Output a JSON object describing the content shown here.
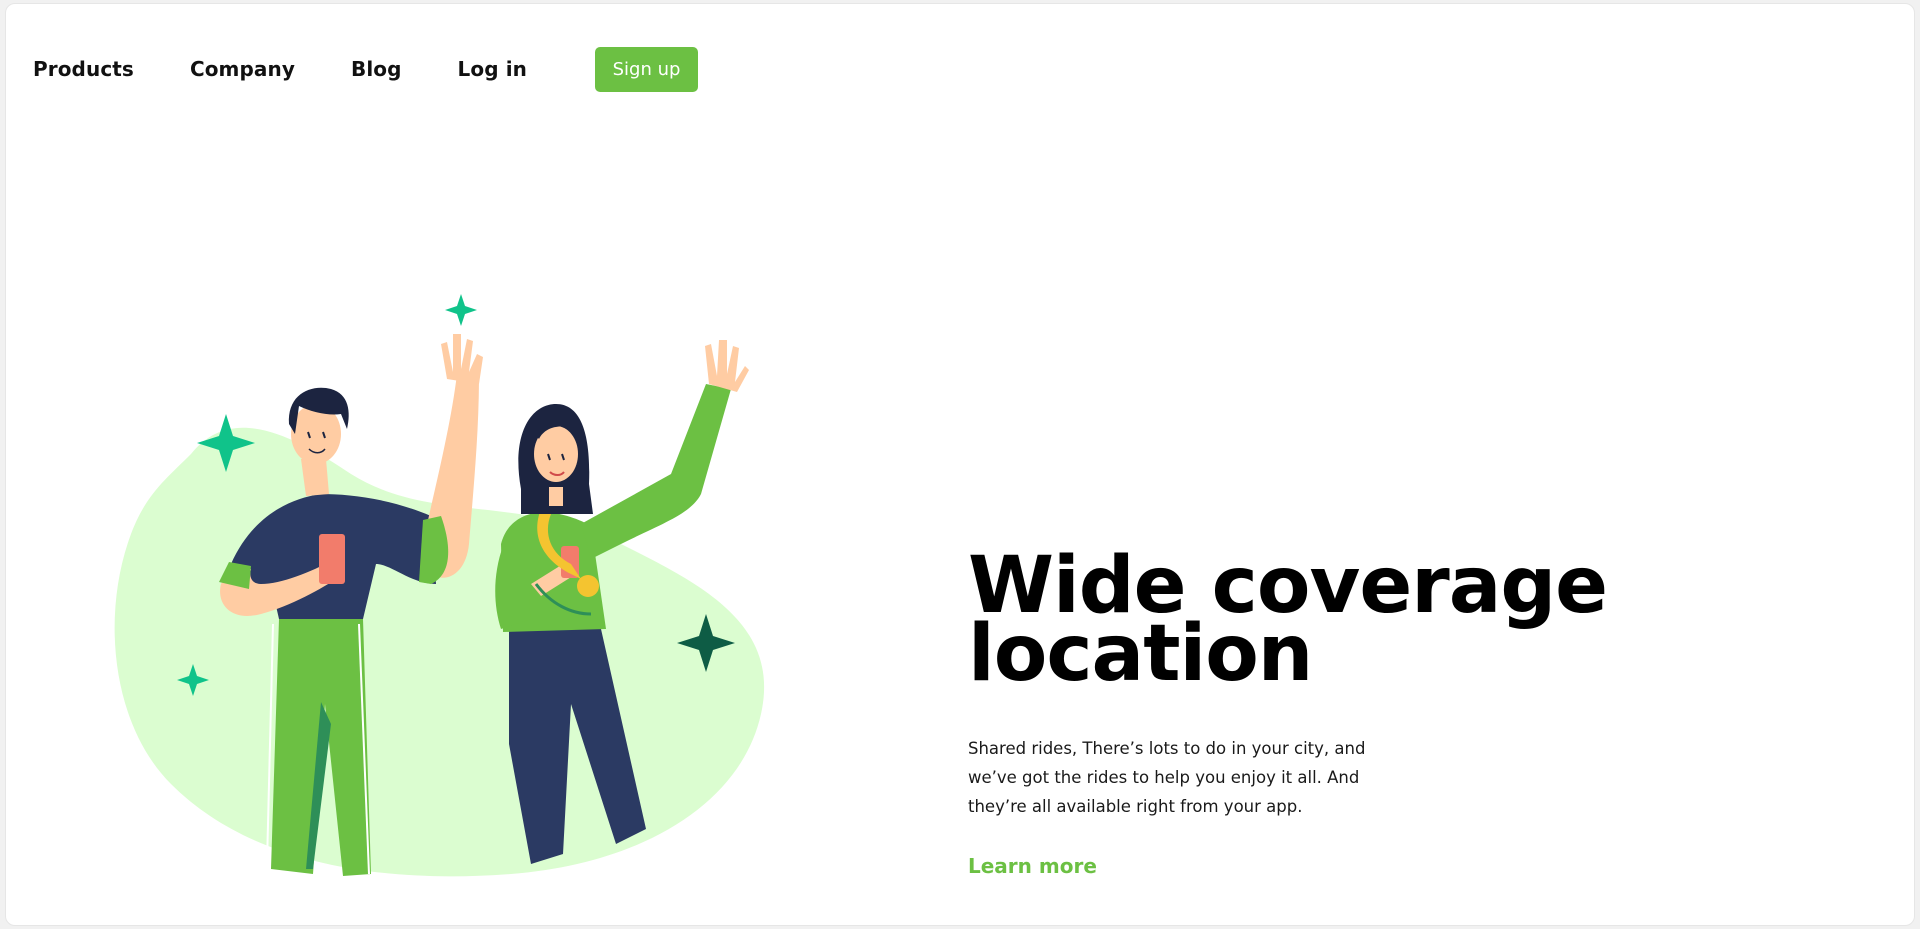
{
  "nav": {
    "items": [
      {
        "label": "Products"
      },
      {
        "label": "Company"
      },
      {
        "label": "Blog"
      },
      {
        "label": "Log in"
      }
    ],
    "signup_label": "Sign up"
  },
  "hero": {
    "title": "Wide coverage location",
    "description": "Shared rides, There’s lots to do in your city, and we’ve got the rides to help you enjoy it all. And they’re all available right from your app.",
    "cta_label": "Learn more"
  },
  "colors": {
    "accent": "#6cc043",
    "blob": "#dbfdd0",
    "navy": "#2b3a63",
    "sparkle": "#10c38a",
    "sparkle_dark": "#0e5c45",
    "skin": "#ffcca3",
    "phone": "#f27c6b"
  },
  "illustration": {
    "icons": [
      "sparkle-icon",
      "phone-icon",
      "medal-icon"
    ]
  }
}
